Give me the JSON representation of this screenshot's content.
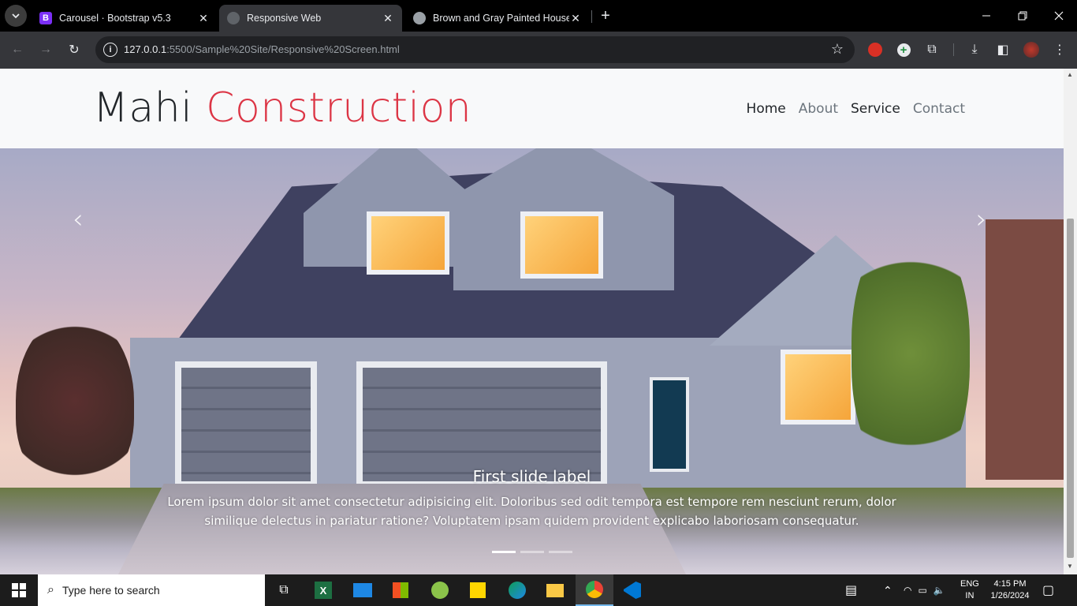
{
  "browser": {
    "tabs": [
      {
        "title": "Carousel · Bootstrap v5.3",
        "favicon": "bootstrap-icon"
      },
      {
        "title": "Responsive Web",
        "favicon": "globe-icon",
        "active": true
      },
      {
        "title": "Brown and Gray Painted House",
        "favicon": "globe-icon"
      }
    ],
    "url_host": "127.0.0.1",
    "url_rest": ":5500/Sample%20Site/Responsive%20Screen.html"
  },
  "page": {
    "brand_first": "Mahi",
    "brand_second": "Construction",
    "nav": [
      {
        "label": "Home"
      },
      {
        "label": "About"
      },
      {
        "label": "Service"
      },
      {
        "label": "Contact"
      }
    ],
    "carousel": {
      "caption_title": "First slide label",
      "caption_text": "Lorem ipsum dolor sit amet consectetur adipisicing elit. Doloribus sed odit tempora est tempore rem nesciunt rerum, dolor similique delectus in pariatur ratione? Voluptatem ipsam quidem provident explicabo laboriosam consequatur.",
      "active_slide": 1,
      "slide_count": 3,
      "prev_glyph": "‹",
      "next_glyph": "›"
    }
  },
  "taskbar": {
    "search_placeholder": "Type here to search",
    "lang": "ENG",
    "region": "IN",
    "time": "4:15 PM",
    "date": "1/26/2024"
  },
  "colors": {
    "accent": "#dc3545",
    "navbar_bg": "#f8f9fa",
    "chrome_bg": "#35363a"
  }
}
